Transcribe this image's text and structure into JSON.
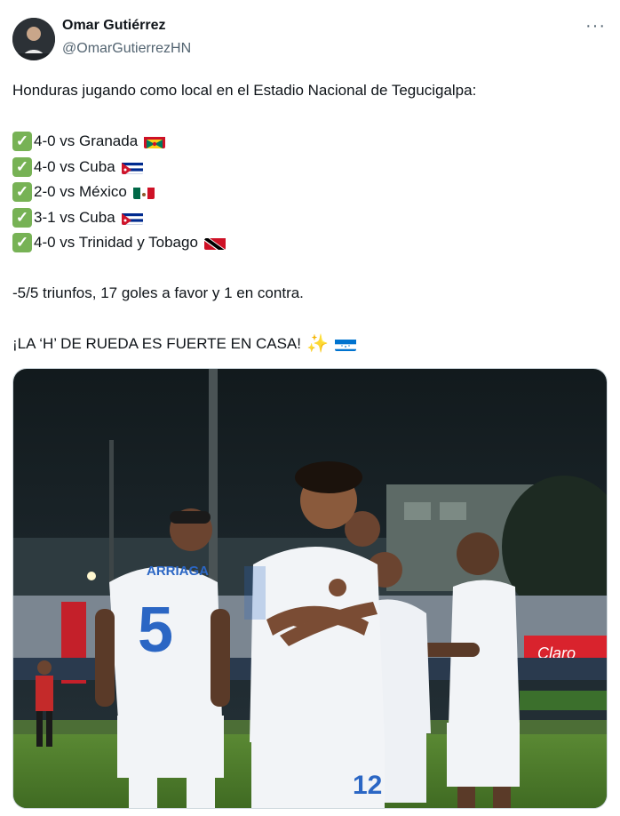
{
  "author": {
    "name": "Omar Gutiérrez",
    "handle": "@OmarGutierrezHN",
    "avatar_icon": "user-avatar-icon"
  },
  "more_icon": "more-options-icon",
  "tweet": {
    "intro": "Honduras jugando como local en el Estadio Nacional de Tegucigalpa:",
    "results": [
      {
        "score": "4-0 vs Granada",
        "flag": "grenada-flag-icon"
      },
      {
        "score": "4-0 vs Cuba",
        "flag": "cuba-flag-icon"
      },
      {
        "score": "2-0 vs México",
        "flag": "mexico-flag-icon"
      },
      {
        "score": "3-1 vs Cuba",
        "flag": "cuba-flag-icon"
      },
      {
        "score": "4-0 vs Trinidad y Tobago",
        "flag": "trinidad-tobago-flag-icon"
      }
    ],
    "summary": "-5/5 triunfos, 17 goles a favor y 1 en contra.",
    "closing": "¡LA ‘H’ DE RUEDA ES FUERTE EN CASA!",
    "check_icon": "check-mark-icon",
    "sparkles_icon": "sparkles-icon",
    "closing_flag": "honduras-flag-icon"
  },
  "photo": {
    "jersey_name": "ARRIAGA",
    "jersey_number_left": "5",
    "jersey_number_center": "12",
    "banner_text": "Claro"
  },
  "colors": {
    "check_green": "#77b255",
    "pitch_green": "#4d7a2c",
    "jersey_white": "#f2f4f7",
    "honduras_blue": "#2b66c4",
    "claro_red": "#d9232d"
  }
}
